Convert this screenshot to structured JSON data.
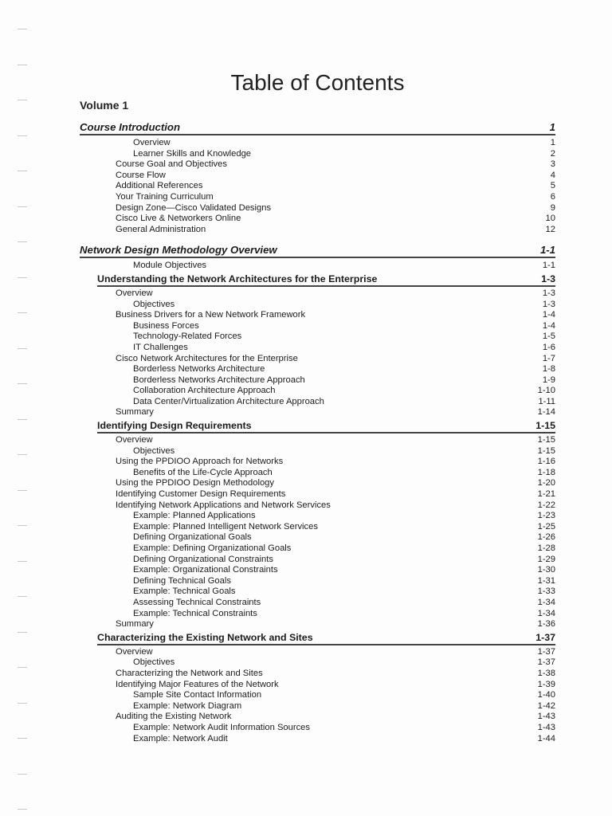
{
  "document": {
    "title": "Table of Contents",
    "volume": "Volume 1"
  },
  "toc": [
    {
      "type": "module",
      "text": "Course Introduction",
      "page": "1"
    },
    {
      "type": "entry",
      "level": 2,
      "text": "Overview",
      "page": "1"
    },
    {
      "type": "entry",
      "level": 2,
      "text": "Learner Skills and Knowledge",
      "page": "2"
    },
    {
      "type": "entry",
      "level": 1,
      "text": "Course Goal and Objectives",
      "page": "3"
    },
    {
      "type": "entry",
      "level": 1,
      "text": "Course Flow",
      "page": "4"
    },
    {
      "type": "entry",
      "level": 1,
      "text": "Additional References",
      "page": "5"
    },
    {
      "type": "entry",
      "level": 1,
      "text": "Your Training Curriculum",
      "page": "6"
    },
    {
      "type": "entry",
      "level": 1,
      "text": "Design Zone—Cisco Validated Designs",
      "page": "9"
    },
    {
      "type": "entry",
      "level": 1,
      "text": "Cisco Live & Networkers Online",
      "page": "10"
    },
    {
      "type": "entry",
      "level": 1,
      "text": "General Administration",
      "page": "12"
    },
    {
      "type": "module",
      "text": "Network Design Methodology Overview",
      "page": "1-1"
    },
    {
      "type": "entry",
      "level": 2,
      "text": "Module Objectives",
      "page": "1-1"
    },
    {
      "type": "lesson",
      "text": "Understanding the Network Architectures for the Enterprise",
      "page": "1-3"
    },
    {
      "type": "entry",
      "level": 1,
      "text": "Overview",
      "page": "1-3"
    },
    {
      "type": "entry",
      "level": 2,
      "text": "Objectives",
      "page": "1-3"
    },
    {
      "type": "entry",
      "level": 1,
      "text": "Business Drivers for a New Network Framework",
      "page": "1-4"
    },
    {
      "type": "entry",
      "level": 2,
      "text": "Business Forces",
      "page": "1-4"
    },
    {
      "type": "entry",
      "level": 2,
      "text": "Technology-Related Forces",
      "page": "1-5"
    },
    {
      "type": "entry",
      "level": 2,
      "text": "IT Challenges",
      "page": "1-6"
    },
    {
      "type": "entry",
      "level": 1,
      "text": "Cisco Network Architectures for the Enterprise",
      "page": "1-7"
    },
    {
      "type": "entry",
      "level": 2,
      "text": "Borderless Networks Architecture",
      "page": "1-8"
    },
    {
      "type": "entry",
      "level": 2,
      "text": "Borderless Networks Architecture Approach",
      "page": "1-9"
    },
    {
      "type": "entry",
      "level": 2,
      "text": "Collaboration Architecture Approach",
      "page": "1-10"
    },
    {
      "type": "entry",
      "level": 2,
      "text": "Data Center/Virtualization Architecture Approach",
      "page": "1-11"
    },
    {
      "type": "entry",
      "level": 1,
      "text": "Summary",
      "page": "1-14"
    },
    {
      "type": "lesson",
      "text": "Identifying Design Requirements",
      "page": "1-15"
    },
    {
      "type": "entry",
      "level": 1,
      "text": "Overview",
      "page": "1-15"
    },
    {
      "type": "entry",
      "level": 2,
      "text": "Objectives",
      "page": "1-15"
    },
    {
      "type": "entry",
      "level": 1,
      "text": "Using the PPDIOO Approach for Networks",
      "page": "1-16"
    },
    {
      "type": "entry",
      "level": 2,
      "text": "Benefits of the Life-Cycle Approach",
      "page": "1-18"
    },
    {
      "type": "entry",
      "level": 1,
      "text": "Using the PPDIOO Design Methodology",
      "page": "1-20"
    },
    {
      "type": "entry",
      "level": 1,
      "text": "Identifying Customer Design Requirements",
      "page": "1-21"
    },
    {
      "type": "entry",
      "level": 1,
      "text": "Identifying Network Applications and Network Services",
      "page": "1-22"
    },
    {
      "type": "entry",
      "level": 2,
      "text": "Example: Planned Applications",
      "page": "1-23"
    },
    {
      "type": "entry",
      "level": 2,
      "text": "Example: Planned Intelligent Network Services",
      "page": "1-25"
    },
    {
      "type": "entry",
      "level": 2,
      "text": "Defining Organizational Goals",
      "page": "1-26"
    },
    {
      "type": "entry",
      "level": 2,
      "text": "Example: Defining Organizational Goals",
      "page": "1-28"
    },
    {
      "type": "entry",
      "level": 2,
      "text": "Defining Organizational Constraints",
      "page": "1-29"
    },
    {
      "type": "entry",
      "level": 2,
      "text": "Example: Organizational Constraints",
      "page": "1-30"
    },
    {
      "type": "entry",
      "level": 2,
      "text": "Defining Technical Goals",
      "page": "1-31"
    },
    {
      "type": "entry",
      "level": 2,
      "text": "Example: Technical Goals",
      "page": "1-33"
    },
    {
      "type": "entry",
      "level": 2,
      "text": "Assessing Technical Constraints",
      "page": "1-34"
    },
    {
      "type": "entry",
      "level": 2,
      "text": "Example: Technical Constraints",
      "page": "1-34"
    },
    {
      "type": "entry",
      "level": 1,
      "text": "Summary",
      "page": "1-36"
    },
    {
      "type": "lesson",
      "text": "Characterizing the Existing Network and Sites",
      "page": "1-37"
    },
    {
      "type": "entry",
      "level": 1,
      "text": "Overview",
      "page": "1-37"
    },
    {
      "type": "entry",
      "level": 2,
      "text": "Objectives",
      "page": "1-37"
    },
    {
      "type": "entry",
      "level": 1,
      "text": "Characterizing the Network and Sites",
      "page": "1-38"
    },
    {
      "type": "entry",
      "level": 1,
      "text": "Identifying Major Features of the Network",
      "page": "1-39"
    },
    {
      "type": "entry",
      "level": 2,
      "text": "Sample Site Contact Information",
      "page": "1-40"
    },
    {
      "type": "entry",
      "level": 2,
      "text": "Example: Network Diagram",
      "page": "1-42"
    },
    {
      "type": "entry",
      "level": 1,
      "text": "Auditing the Existing Network",
      "page": "1-43"
    },
    {
      "type": "entry",
      "level": 2,
      "text": "Example: Network Audit Information Sources",
      "page": "1-43"
    },
    {
      "type": "entry",
      "level": 2,
      "text": "Example: Network Audit",
      "page": "1-44"
    }
  ]
}
